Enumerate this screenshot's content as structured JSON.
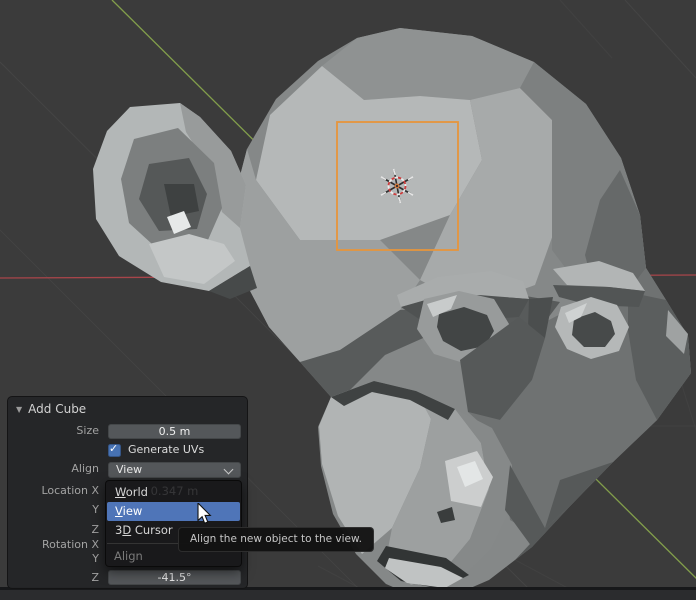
{
  "colors": {
    "viewport_bg": "#3b3b3b",
    "accent_orange": "#e6953c",
    "highlight_blue": "#4f75b8",
    "checkbox_blue": "#4772b3",
    "axis_x_red": "#a8454a",
    "axis_y_green": "#86a44c"
  },
  "panel": {
    "title": "Add Cube",
    "rows": {
      "size": {
        "label": "Size",
        "value": "0.5 m"
      },
      "generate_uvs": {
        "label": "Generate UVs",
        "checked": true
      },
      "align": {
        "label": "Align",
        "value": "View"
      },
      "location_x": {
        "label": "Location X",
        "ghost_value": "0.347 m"
      },
      "location_y": {
        "label": "Y"
      },
      "location_z": {
        "label": "Z"
      },
      "rotation_x": {
        "label": "Rotation X"
      },
      "rotation_y": {
        "label": "Y"
      },
      "rotation_z": {
        "label": "Z",
        "value": "-41.5°"
      }
    }
  },
  "dropdown": {
    "items": [
      {
        "label": "World",
        "underline_index": 0,
        "state": "normal"
      },
      {
        "label": "View",
        "underline_index": 0,
        "state": "highlighted"
      },
      {
        "label": "3D Cursor",
        "underline_index": 1,
        "state": "normal"
      }
    ],
    "footer_label": "Align"
  },
  "tooltip": {
    "text": "Align the new object to the view."
  },
  "viewport": {
    "selected_object": "Cube",
    "mesh_object": "Suzanne"
  }
}
